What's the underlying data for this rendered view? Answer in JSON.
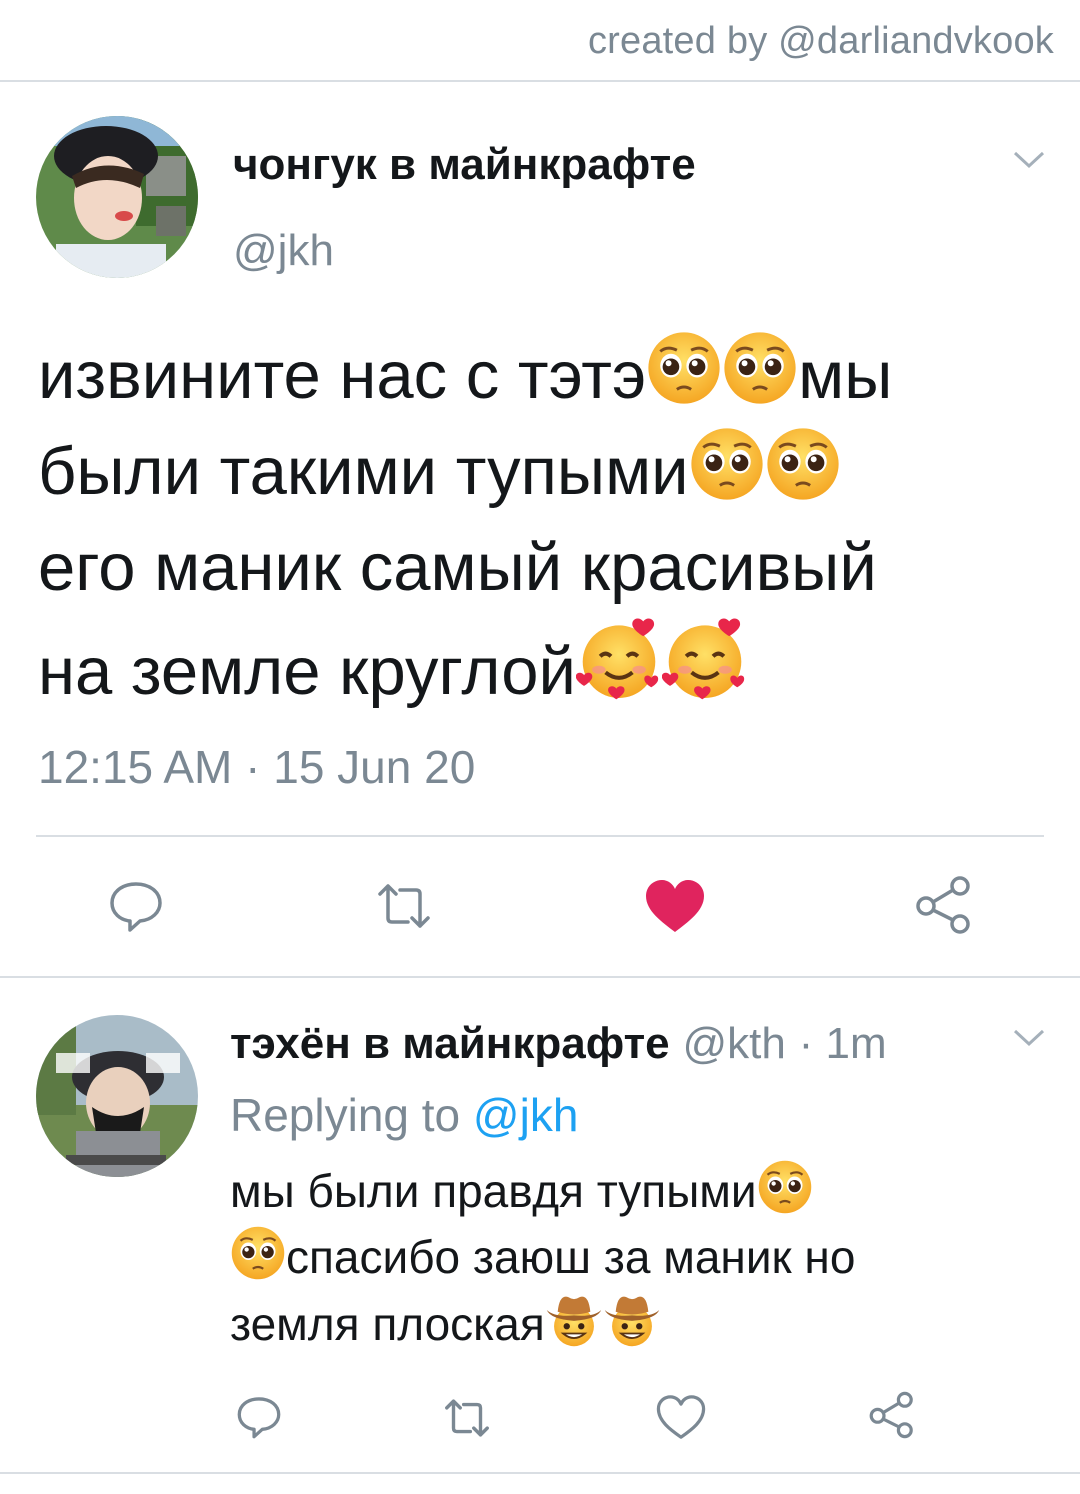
{
  "credit": "created by @darliandvkook",
  "main_tweet": {
    "name": "чонгук в майнкрафте",
    "handle": "@jkh",
    "text": {
      "part1": "извините нас с тэтэ",
      "part2": "мы",
      "part3": "были такими тупыми",
      "part4": "его маник самый красивый",
      "part5": "на земле круглой"
    },
    "timestamp": "12:15 AM · 15 Jun 20",
    "icons": [
      "reply-icon",
      "retweet-icon",
      "like-icon",
      "share-icon"
    ],
    "liked": true
  },
  "reply_tweet": {
    "name": "тэхён в майнкрафте",
    "handle": "@kth",
    "age": "· 1m",
    "replying_prefix": "Replying to ",
    "replying_handle": "@jkh",
    "text": {
      "part1": "мы были правдя тупыми",
      "part2": "спасибо заюш за маник но",
      "part3": "земля плоская"
    },
    "icons": [
      "reply-icon",
      "retweet-icon",
      "like-icon",
      "share-icon"
    ],
    "liked": false
  },
  "colors": {
    "text": "#14171a",
    "muted": "#7b8893",
    "link": "#1da1f2",
    "like": "#e0245e",
    "divider": "#d9dee3"
  },
  "emojis": {
    "pleading": "pleading-face-emoji",
    "hearts": "smiling-face-with-hearts-emoji",
    "cowboy": "cowboy-face-emoji"
  }
}
